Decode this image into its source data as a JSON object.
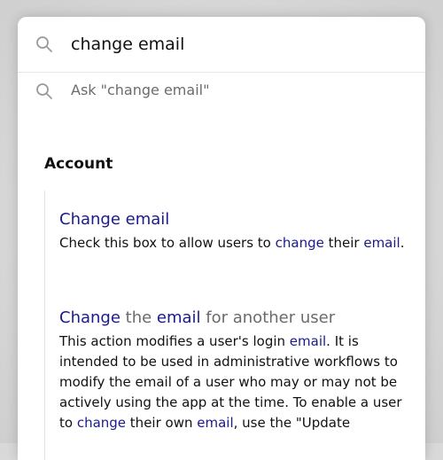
{
  "search": {
    "query": "change email",
    "icon": "search-icon"
  },
  "ask": {
    "label": "Ask \"change email\"",
    "icon": "search-icon"
  },
  "section": {
    "title": "Account"
  },
  "results": [
    {
      "title": "Change email",
      "description": [
        {
          "text": "Check this box to allow users to ",
          "highlight": false
        },
        {
          "text": "change",
          "highlight": true
        },
        {
          "text": " their ",
          "highlight": false
        },
        {
          "text": "email",
          "highlight": true
        },
        {
          "text": ".",
          "highlight": false
        }
      ]
    },
    {
      "title_parts": [
        {
          "text": "Change",
          "highlight": true
        },
        {
          "text": " the ",
          "highlight": false
        },
        {
          "text": "email",
          "highlight": true
        },
        {
          "text": " for another user",
          "highlight": false
        }
      ],
      "description": [
        {
          "text": "This action modifies a user's login ",
          "highlight": false
        },
        {
          "text": "email",
          "highlight": true
        },
        {
          "text": ". It is intended to be used in administrative workflows to modify the email of a user who may or may not be actively using the app at the time. To enable a user to ",
          "highlight": false
        },
        {
          "text": "change",
          "highlight": true
        },
        {
          "text": " their own ",
          "highlight": false
        },
        {
          "text": "email",
          "highlight": true
        },
        {
          "text": ", use the \"Update",
          "highlight": false
        }
      ]
    }
  ],
  "colors": {
    "link": "#1a1a8c",
    "muted": "#6b6b6b",
    "text": "#111111"
  }
}
